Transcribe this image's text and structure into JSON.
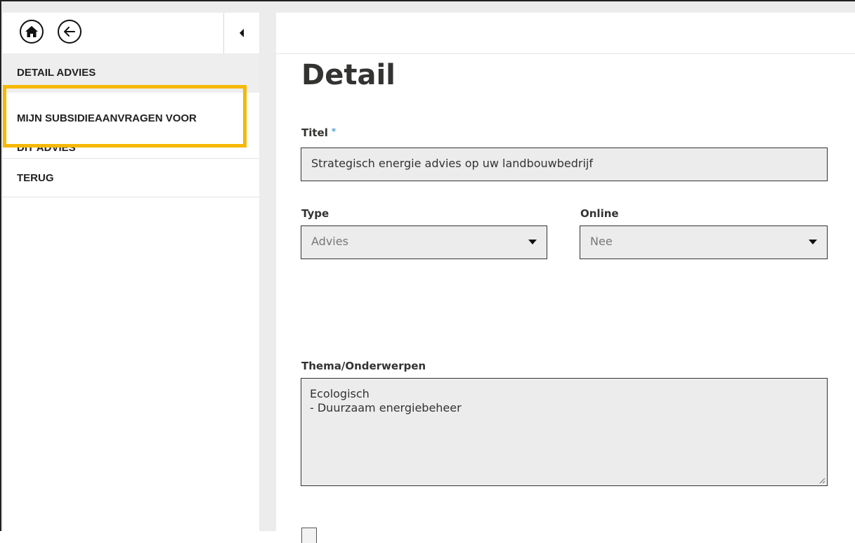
{
  "sidebar": {
    "home_icon": "home-icon",
    "back_icon": "arrow-left-icon",
    "collapse_icon": "caret-left-icon",
    "items": [
      {
        "label": "DETAIL ADVIES"
      },
      {
        "label_line1": "MIJN SUBSIDIEAANVRAGEN VOOR",
        "label_line2": "DIT ADVIES"
      },
      {
        "label": "TERUG"
      }
    ]
  },
  "main": {
    "title": "Detail",
    "titel_label": "Titel",
    "required_mark": "*",
    "titel_value": "Strategisch energie advies op uw landbouwbedrijf",
    "type_label": "Type",
    "type_value": "Advies",
    "online_label": "Online",
    "online_value": "Nee",
    "thema_label": "Thema/Onderwerpen",
    "thema_line1": "Ecologisch",
    "thema_line2": "- Duurzaam energiebeheer"
  },
  "colors": {
    "highlight": "#f6b800",
    "required": "#4aa3d8",
    "field_bg": "#ececec"
  }
}
